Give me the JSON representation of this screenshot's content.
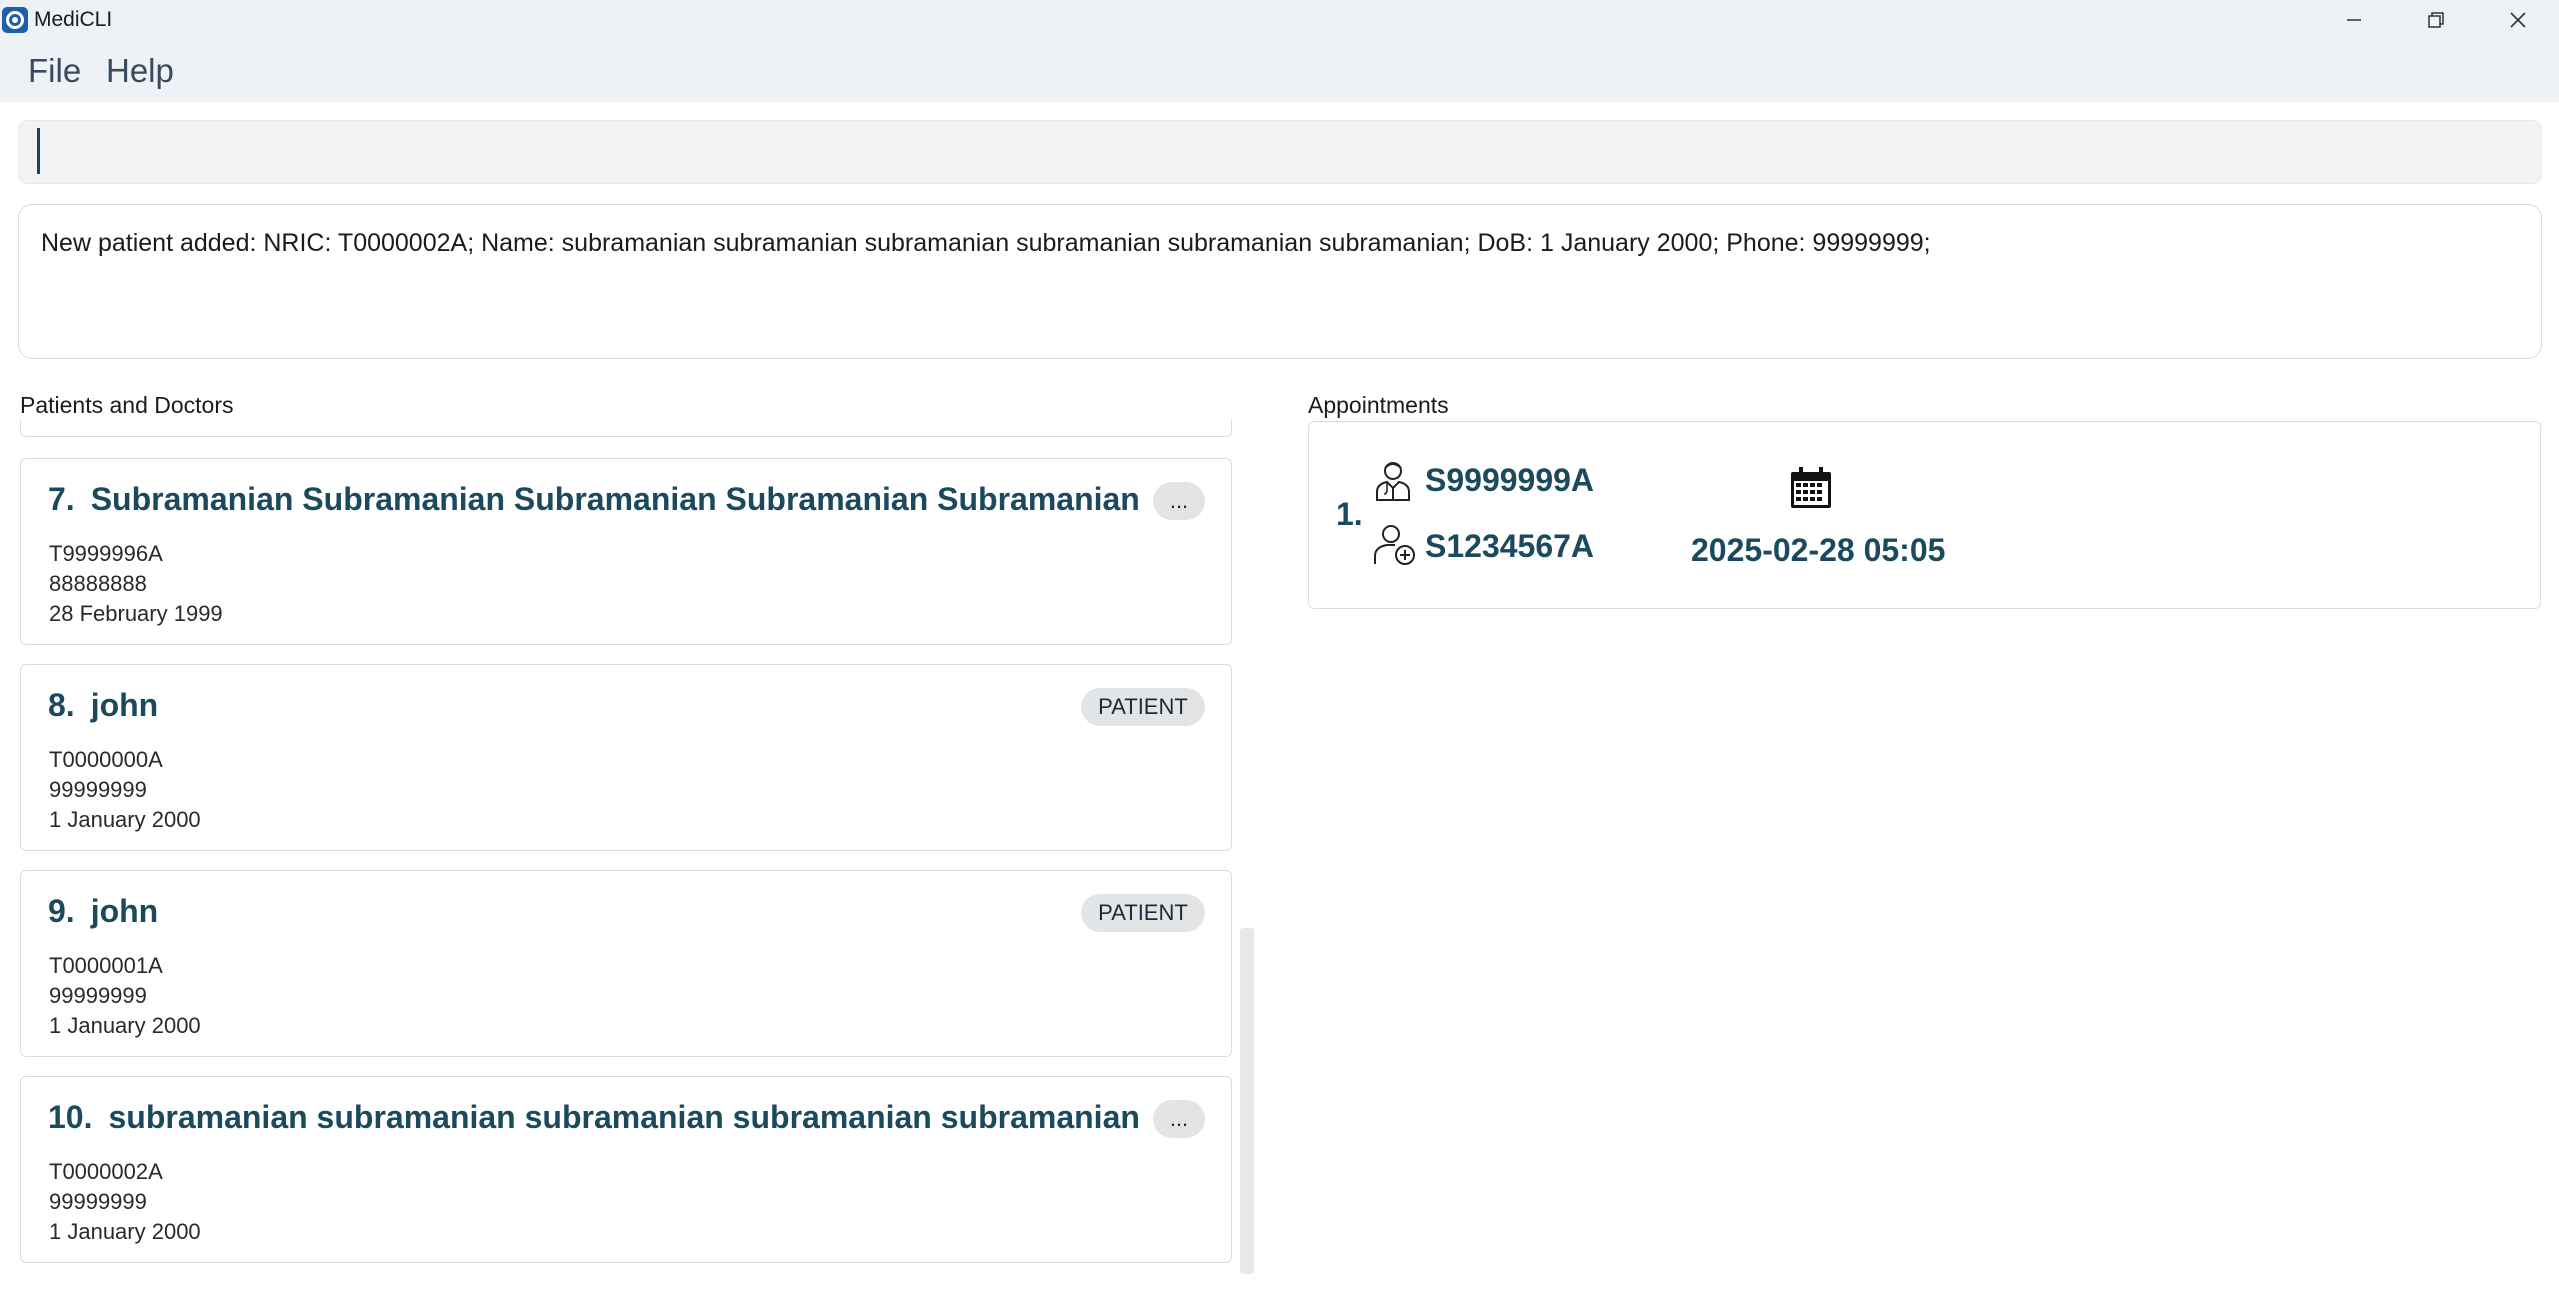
{
  "window": {
    "title": "MediCLI"
  },
  "menu": {
    "items": [
      "File",
      "Help"
    ]
  },
  "command": {
    "value": ""
  },
  "result": {
    "text": "New patient added: NRIC: T0000002A; Name: subramanian subramanian subramanian subramanian subramanian subramanian; DoB: 1 January 2000; Phone: 99999999;"
  },
  "sections": {
    "left_label": "Patients and Doctors",
    "right_label": "Appointments"
  },
  "persons": [
    {
      "index": "7.",
      "name": "Subramanian Subramanian Subramanian Subramanian Subramanian S...",
      "tag": "...",
      "nric": "T9999996A",
      "phone": "88888888",
      "dob": "28 February 1999"
    },
    {
      "index": "8.",
      "name": "john",
      "tag": "PATIENT",
      "nric": "T0000000A",
      "phone": "99999999",
      "dob": "1 January 2000"
    },
    {
      "index": "9.",
      "name": "john",
      "tag": "PATIENT",
      "nric": "T0000001A",
      "phone": "99999999",
      "dob": "1 January 2000"
    },
    {
      "index": "10.",
      "name": "subramanian subramanian subramanian subramanian subramanian su...",
      "tag": "...",
      "nric": "T0000002A",
      "phone": "99999999",
      "dob": "1 January 2000"
    }
  ],
  "appointments": [
    {
      "index": "1.",
      "doctor_nric": "S9999999A",
      "patient_nric": "S1234567A",
      "datetime": "2025-02-28 05:05",
      "icons": [
        "doctor-icon",
        "patient-icon",
        "calendar-icon"
      ]
    }
  ]
}
